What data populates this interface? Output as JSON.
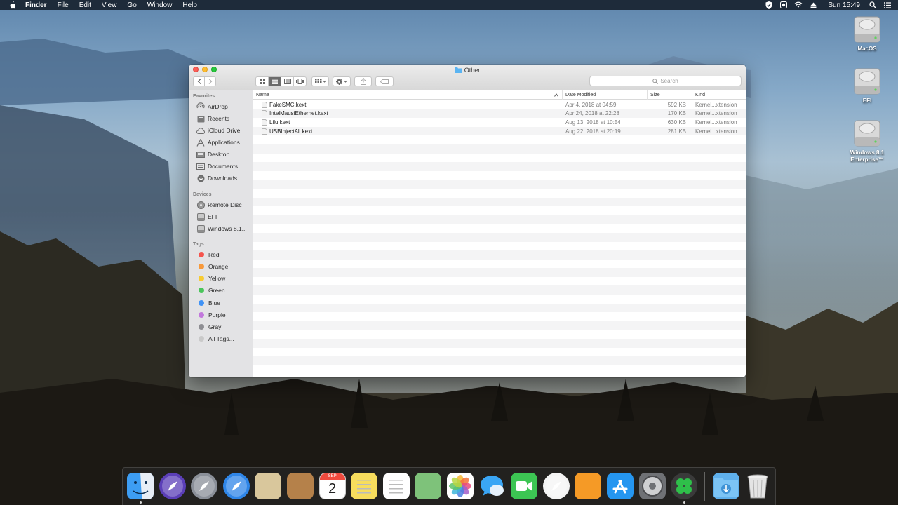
{
  "menubar": {
    "app_name": "Finder",
    "menus": [
      "File",
      "Edit",
      "View",
      "Go",
      "Window",
      "Help"
    ],
    "clock": "Sun 15:49",
    "status_icons": [
      "vpn-shield-icon",
      "app-status-icon",
      "wifi-icon",
      "eject-icon",
      "spotlight-icon",
      "notification-list-icon"
    ]
  },
  "desktop": {
    "icons": [
      {
        "label": "MacOS",
        "icon": "hard-drive-icon"
      },
      {
        "label": "EFI",
        "icon": "hard-drive-icon"
      },
      {
        "label": "Windows 8.1 Enterprise™",
        "icon": "hard-drive-icon"
      }
    ]
  },
  "window": {
    "title": "Other",
    "search_placeholder": "Search",
    "toolbar_icons": [
      "back-icon",
      "forward-icon",
      "icon-view-icon",
      "list-view-icon",
      "column-view-icon",
      "cover-flow-icon",
      "group-icon",
      "action-gear-icon",
      "share-icon",
      "tag-icon"
    ]
  },
  "sidebar": {
    "favorites_heading": "Favorites",
    "favorites": [
      {
        "label": "AirDrop",
        "icon": "airdrop-icon"
      },
      {
        "label": "Recents",
        "icon": "recents-icon"
      },
      {
        "label": "iCloud Drive",
        "icon": "cloud-icon"
      },
      {
        "label": "Applications",
        "icon": "applications-icon"
      },
      {
        "label": "Desktop",
        "icon": "desktop-icon"
      },
      {
        "label": "Documents",
        "icon": "documents-icon"
      },
      {
        "label": "Downloads",
        "icon": "downloads-icon"
      }
    ],
    "devices_heading": "Devices",
    "devices": [
      {
        "label": "Remote Disc",
        "icon": "disc-icon"
      },
      {
        "label": "EFI",
        "icon": "drive-icon"
      },
      {
        "label": "Windows 8.1...",
        "icon": "drive-icon"
      }
    ],
    "tags_heading": "Tags",
    "tags": [
      {
        "label": "Red",
        "color": "#f5544d"
      },
      {
        "label": "Orange",
        "color": "#f8993a"
      },
      {
        "label": "Yellow",
        "color": "#f7cb31"
      },
      {
        "label": "Green",
        "color": "#4ac55b"
      },
      {
        "label": "Blue",
        "color": "#3f92f6"
      },
      {
        "label": "Purple",
        "color": "#c278dc"
      },
      {
        "label": "Gray",
        "color": "#8e8e93"
      },
      {
        "label": "All Tags...",
        "color": "#c9c9c9"
      }
    ]
  },
  "list": {
    "columns": {
      "name": "Name",
      "date": "Date Modified",
      "size": "Size",
      "kind": "Kind"
    },
    "files": [
      {
        "name": "FakeSMC.kext",
        "date": "Apr 4, 2018 at 04:59",
        "size": "592 KB",
        "kind": "Kernel...xtension"
      },
      {
        "name": "IntelMausiEthernet.kext",
        "date": "Apr 24, 2018 at 22:28",
        "size": "170 KB",
        "kind": "Kernel...xtension"
      },
      {
        "name": "Lilu.kext",
        "date": "Aug 13, 2018 at 10:54",
        "size": "630 KB",
        "kind": "Kernel...xtension"
      },
      {
        "name": "USBInjectAll.kext",
        "date": "Aug 22, 2018 at 20:19",
        "size": "281 KB",
        "kind": "Kernel...xtension"
      }
    ]
  },
  "dock": {
    "calendar_month": "SEP",
    "calendar_day": "2",
    "apps": [
      {
        "name": "finder-icon",
        "color": "#3d9df3",
        "running": true
      },
      {
        "name": "siri-icon",
        "color": "#5b3fb8",
        "running": false
      },
      {
        "name": "launchpad-icon",
        "color": "#8a8f98",
        "running": false
      },
      {
        "name": "safari-icon",
        "color": "#2f86e8",
        "running": false
      },
      {
        "name": "mail-icon",
        "color": "#d9c79c",
        "running": false
      },
      {
        "name": "contacts-icon",
        "color": "#b5814a",
        "running": false
      },
      {
        "name": "calendar-icon",
        "color": "#ffffff",
        "running": false
      },
      {
        "name": "notes-icon",
        "color": "#f7dd5d",
        "running": false
      },
      {
        "name": "reminders-icon",
        "color": "#ffffff",
        "running": false
      },
      {
        "name": "maps-icon",
        "color": "#7ec27a",
        "running": false
      },
      {
        "name": "photos-icon",
        "color": "#ffffff",
        "running": false
      },
      {
        "name": "messages-icon",
        "color": "#3aa6f5",
        "running": false
      },
      {
        "name": "facetime-icon",
        "color": "#3cc553",
        "running": false
      },
      {
        "name": "itunes-icon",
        "color": "#f4f4f4",
        "running": false
      },
      {
        "name": "ibooks-icon",
        "color": "#f59a26",
        "running": false
      },
      {
        "name": "app-store-icon",
        "color": "#2596f0",
        "running": false
      },
      {
        "name": "system-preferences-icon",
        "color": "#6f7175",
        "running": false
      },
      {
        "name": "clover-configurator-icon",
        "color": "#3a3a3a",
        "running": true
      },
      {
        "name": "downloads-stack-icon",
        "color": "#5fb0ec",
        "running": false
      },
      {
        "name": "trash-icon",
        "color": "#d9d9d9",
        "running": false
      }
    ]
  }
}
